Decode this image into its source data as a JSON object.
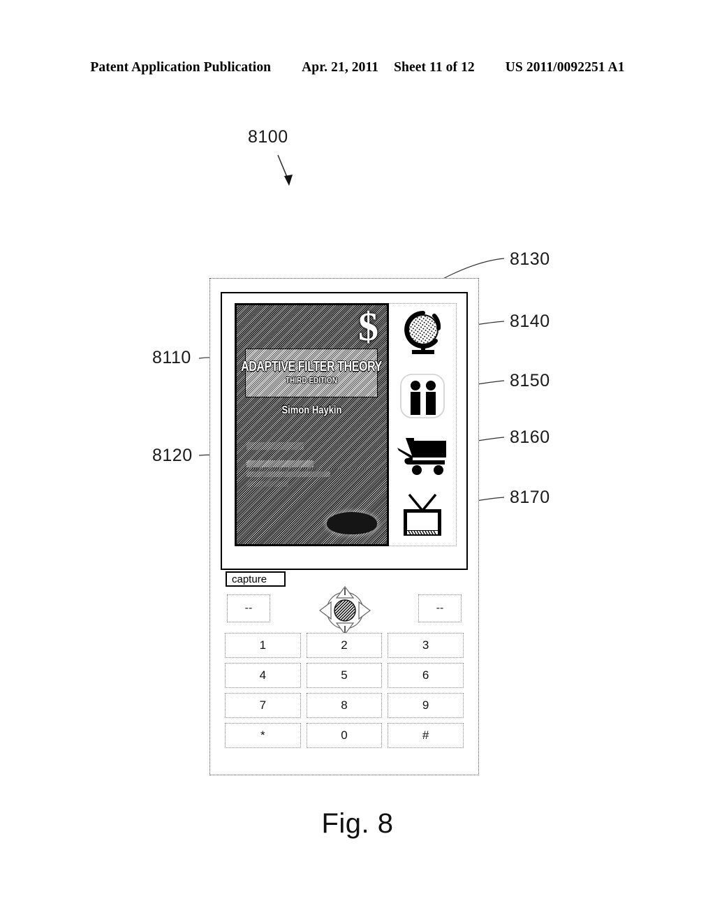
{
  "header": {
    "publication": "Patent Application Publication",
    "date": "Apr. 21, 2011",
    "sheet": "Sheet 11 of 12",
    "number": "US 2011/0092251 A1"
  },
  "figure": {
    "caption": "Fig. 8",
    "callouts": [
      {
        "id": "8100",
        "target": "device-overall"
      },
      {
        "id": "8110",
        "target": "book-title-region"
      },
      {
        "id": "8120",
        "target": "book-lower-region"
      },
      {
        "id": "8130",
        "target": "captured-image"
      },
      {
        "id": "8140",
        "target": "globe-icon"
      },
      {
        "id": "8150",
        "target": "people-icon"
      },
      {
        "id": "8160",
        "target": "cart-icon"
      },
      {
        "id": "8170",
        "target": "tv-icon"
      }
    ]
  },
  "device": {
    "screen": {
      "book": {
        "currency_symbol": "$",
        "title": "ADAPTIVE FILTER THEORY",
        "edition": "THIRD EDITION",
        "author": "Simon Haykin"
      },
      "icons": [
        {
          "name": "globe-icon",
          "label": "Globe"
        },
        {
          "name": "people-icon",
          "label": "People"
        },
        {
          "name": "shopping-cart-icon",
          "label": "Shopping Cart"
        },
        {
          "name": "tv-icon",
          "label": "Television"
        }
      ]
    },
    "capture_label": "capture",
    "softkeys": [
      {
        "name": "softkey-left",
        "label": "--"
      },
      {
        "name": "softkey-right",
        "label": "--"
      }
    ],
    "dpad": {
      "up": "up-arrow",
      "down": "down-arrow",
      "left": "left-arrow",
      "right": "right-arrow",
      "center": "select-button"
    },
    "keypad": [
      "1",
      "2",
      "3",
      "4",
      "5",
      "6",
      "7",
      "8",
      "9",
      "*",
      "0",
      "#"
    ]
  },
  "colors": {
    "ink": "#000000",
    "paper": "#ffffff",
    "dotted_border": "#8a8a8a"
  }
}
